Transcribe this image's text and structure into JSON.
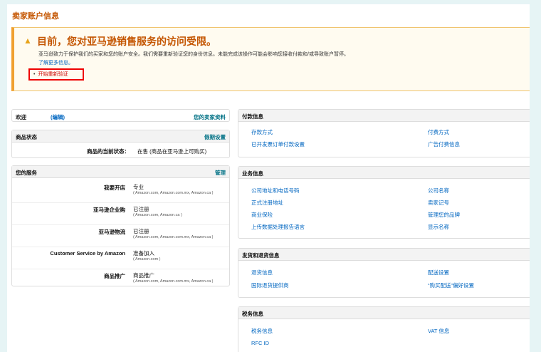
{
  "page_title": "卖家账户信息",
  "alert": {
    "heading": "目前，您对亚马逊销售服务的访问受限。",
    "text": "亚马逊致力于保护我们的买家和您的账户安全。我们需要重新验证您的身份信息。未能完成该操作可能会影响您接收付款和/或导致账户暂停。",
    "learn_more": "了解更多信息。",
    "verify_link": "开始重新验证"
  },
  "welcome": {
    "label": "欢迎",
    "edit": "(编辑)",
    "profile_link": "您的卖家资料"
  },
  "listing_status": {
    "title": "商品状态",
    "action": "假期设置",
    "key": "商品的当前状态：",
    "value": "在售 (商品在亚马逊上可购买)"
  },
  "services": {
    "title": "您的服务",
    "action": "管理",
    "rows": [
      {
        "name": "我要开店",
        "status": "专业",
        "markets": "( Amazon.com, Amazon.com.mx, Amazon.ca )"
      },
      {
        "name": "亚马逊企业购",
        "status": "已注册",
        "markets": "( Amazon.com, Amazon.ca )"
      },
      {
        "name": "亚马逊物流",
        "status": "已注册",
        "markets": "( Amazon.com, Amazon.com.mx, Amazon.ca )"
      },
      {
        "name": "Customer Service by Amazon",
        "status": "准备加入",
        "markets": "( Amazon.com )"
      },
      {
        "name": "商品推广",
        "status": "商品推广",
        "markets": "( Amazon.com, Amazon.com.mx, Amazon.ca )"
      }
    ]
  },
  "payment": {
    "title": "付款信息",
    "links": [
      "存款方式",
      "付费方式",
      "已开发票订单付款设置",
      "广告付费信息"
    ]
  },
  "business": {
    "title": "业务信息",
    "links": [
      "公司地址和电话号码",
      "公司名称",
      "正式注册地址",
      "卖家记号",
      "商业保险",
      "管理您的品牌",
      "上传数据处理报告语言",
      "显示名称"
    ]
  },
  "shipping": {
    "title": "发货和退货信息",
    "links": [
      "退货信息",
      "配送设置",
      "国际退货提供商",
      "“购买配送”偏好设置"
    ]
  },
  "tax": {
    "title": "税务信息",
    "links": [
      "税务信息",
      "VAT 信息",
      "RFC ID"
    ]
  }
}
